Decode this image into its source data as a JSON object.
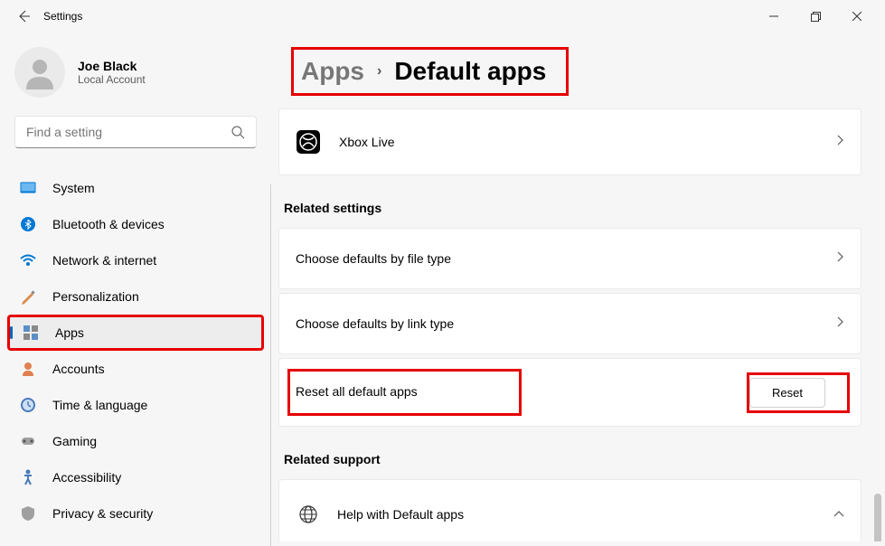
{
  "window": {
    "title": "Settings"
  },
  "user": {
    "name": "Joe Black",
    "type": "Local Account"
  },
  "search": {
    "placeholder": "Find a setting"
  },
  "nav": [
    {
      "id": "system",
      "label": "System"
    },
    {
      "id": "bluetooth",
      "label": "Bluetooth & devices"
    },
    {
      "id": "network",
      "label": "Network & internet"
    },
    {
      "id": "personalization",
      "label": "Personalization"
    },
    {
      "id": "apps",
      "label": "Apps",
      "active": true
    },
    {
      "id": "accounts",
      "label": "Accounts"
    },
    {
      "id": "time",
      "label": "Time & language"
    },
    {
      "id": "gaming",
      "label": "Gaming"
    },
    {
      "id": "accessibility",
      "label": "Accessibility"
    },
    {
      "id": "privacy",
      "label": "Privacy & security"
    }
  ],
  "breadcrumb": {
    "parent": "Apps",
    "current": "Default apps"
  },
  "app_card": {
    "label": "Xbox Live"
  },
  "related_settings": {
    "header": "Related settings",
    "items": [
      {
        "label": "Choose defaults by file type"
      },
      {
        "label": "Choose defaults by link type"
      }
    ],
    "reset": {
      "label": "Reset all default apps",
      "button": "Reset"
    }
  },
  "related_support": {
    "header": "Related support",
    "items": [
      {
        "label": "Help with Default apps"
      }
    ]
  }
}
